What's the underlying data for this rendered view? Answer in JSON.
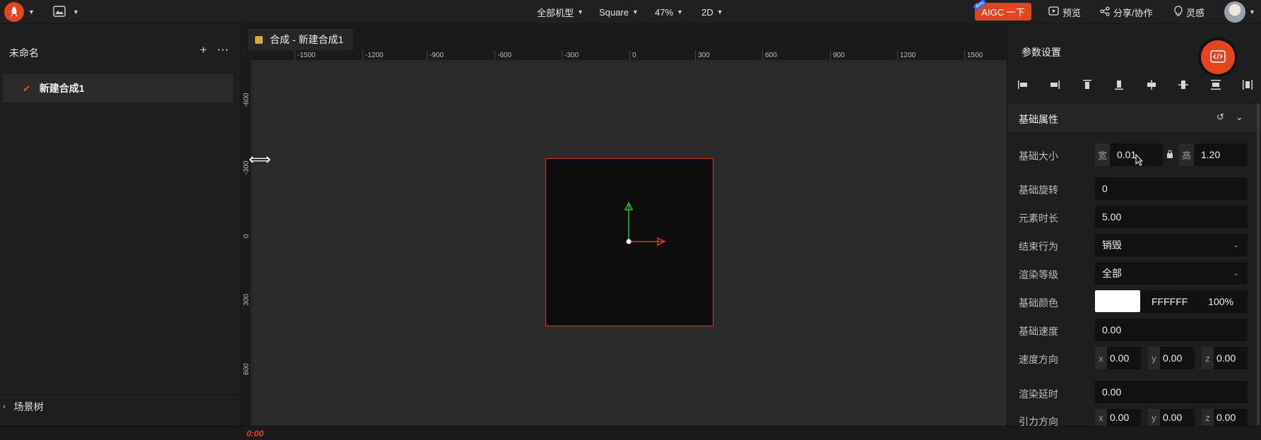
{
  "topbar": {
    "model_filter": "全部机型",
    "aspect": "Square",
    "zoom": "47%",
    "mode": "2D",
    "aigc_label": "AIGC 一下",
    "aigc_badge": "Beta",
    "preview": "预览",
    "share": "分享/协作",
    "inspiration": "灵感"
  },
  "left": {
    "title": "未命名",
    "items": [
      {
        "label": "新建合成1"
      }
    ],
    "scene_tree": "场景树"
  },
  "canvas": {
    "tab": "合成 - 新建合成1",
    "hruler": [
      "-1500",
      "-1200",
      "-900",
      "-600",
      "-300",
      "0",
      "300",
      "600",
      "900",
      "1200",
      "1500"
    ],
    "vruler": [
      "-600",
      "-300",
      "0",
      "300",
      "600"
    ],
    "time": "0:00"
  },
  "right": {
    "title": "参数设置",
    "section": "基础属性",
    "size_label": "基础大小",
    "width_prefix": "宽",
    "width_value": "0.01",
    "height_prefix": "高",
    "height_value": "1.20",
    "rotation_label": "基础旋转",
    "rotation_value": "0",
    "duration_label": "元素时长",
    "duration_value": "5.00",
    "end_label": "结束行为",
    "end_value": "销毁",
    "render_label": "渲染等级",
    "render_value": "全部",
    "color_label": "基础颜色",
    "color_hex": "FFFFFF",
    "color_alpha": "100%",
    "speed_label": "基础速度",
    "speed_value": "0.00",
    "dir_label": "速度方向",
    "dir": {
      "x": "0.00",
      "y": "0.00",
      "z": "0.00"
    },
    "delay_label": "渲染延时",
    "delay_value": "0.00",
    "gravity_label": "引力方向",
    "gravity": {
      "x": "0.00",
      "y": "0.00",
      "z": "0.00"
    },
    "axis_x": "x",
    "axis_y": "y",
    "axis_z": "z"
  },
  "colors": {
    "accent": "#e2451f",
    "artboard_border": "#d33a2a",
    "axis_y": "#22c02a",
    "axis_x": "#d33a2a"
  }
}
